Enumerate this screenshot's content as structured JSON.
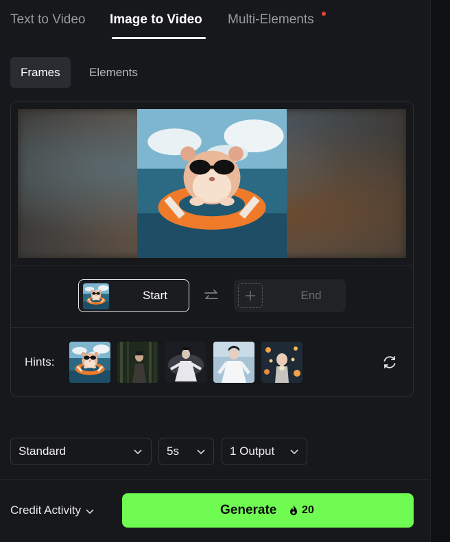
{
  "tabs": [
    {
      "label": "Text to Video",
      "active": false
    },
    {
      "label": "Image to Video",
      "active": true
    },
    {
      "label": "Multi-Elements",
      "active": false,
      "has_notification_dot": true
    }
  ],
  "subtabs": [
    {
      "label": "Frames",
      "active": true
    },
    {
      "label": "Elements",
      "active": false
    }
  ],
  "frames": {
    "start_label": "Start",
    "end_label": "End",
    "swap_icon": "swap-arrows-icon",
    "add_icon": "plus-icon"
  },
  "hints": {
    "label": "Hints:",
    "thumbnails": [
      "hamster-float",
      "forest-warrior",
      "white-warrior",
      "white-robed-figure",
      "flower-lights-girl"
    ],
    "refresh_icon": "refresh-icon"
  },
  "settings": {
    "quality": "Standard",
    "duration": "5s",
    "outputs": "1 Output"
  },
  "footer": {
    "credit_label": "Credit Activity",
    "generate_label": "Generate",
    "cost": "20",
    "cost_icon": "flame-icon"
  },
  "colors": {
    "background": "#17181b",
    "generate_button": "#6ffb52",
    "notification_dot": "#f04034"
  }
}
